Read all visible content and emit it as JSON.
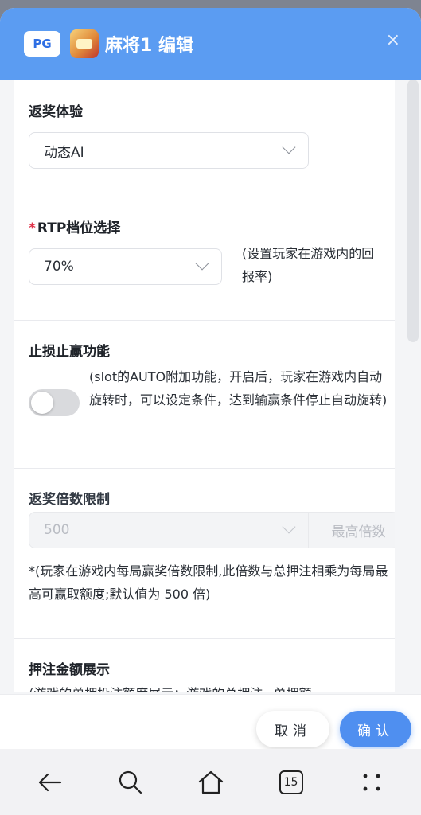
{
  "header": {
    "badge": "PG",
    "title": "麻将1 编辑",
    "close_glyph": "×"
  },
  "sections": {
    "rebate": {
      "label": "返奖体验",
      "value": "动态AI"
    },
    "rtp": {
      "required_mark": "*",
      "label": "RTP档位选择",
      "value": "70%",
      "note": "(设置玩家在游戏内的回报率)"
    },
    "stop_loss": {
      "label": "止损止赢功能",
      "enabled": false,
      "note": "(slot的AUTO附加功能，开启后，玩家在游戏内自动旋转时，可以设定条件，达到输赢条件停止自动旋转)"
    },
    "multiplier": {
      "label": "返奖倍数限制",
      "value": "500",
      "addon": "最高倍数",
      "note": "*(玩家在游戏内每局赢奖倍数限制,此倍数与总押注相乘为每局最高可赢取额度;默认值为 500 倍)"
    },
    "bet_display": {
      "label": "押注金额展示",
      "note": "(游戏的单押投注额度展示；游戏的总押注=单押额"
    }
  },
  "footer": {
    "cancel_label": "取消",
    "confirm_label": "确认"
  },
  "navbar": {
    "tabs_count": "15"
  },
  "colors": {
    "header_bg": "#5b9cf2",
    "primary": "#4f8ff0",
    "required": "#e0344a"
  }
}
